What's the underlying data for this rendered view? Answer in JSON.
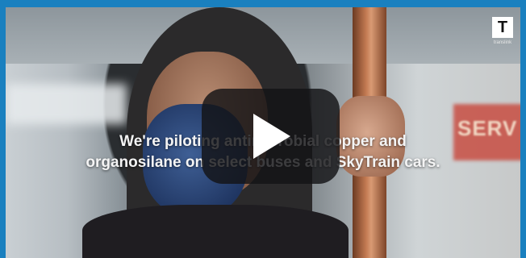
{
  "video": {
    "caption_line1": "We're piloting antimicrobial copper and",
    "caption_line2": "organosilane on select buses and SkyTrain cars.",
    "play_icon": "play-icon"
  },
  "brand": {
    "logo_letter": "T",
    "logo_subtext": "translink"
  },
  "scene": {
    "sign_text": "SERV"
  },
  "colors": {
    "border": "#1a80bf",
    "play_overlay": "#141416",
    "caption": "#f4f4f4"
  }
}
